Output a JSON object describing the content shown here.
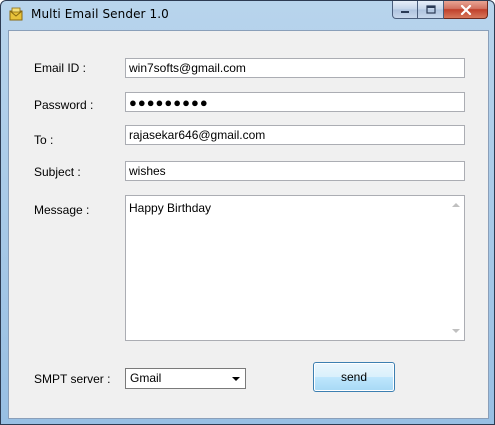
{
  "window": {
    "title": "Multi Email Sender 1.0"
  },
  "form": {
    "email_label": "Email ID :",
    "email_value": "win7softs@gmail.com",
    "password_label": "Password :",
    "password_value": "●●●●●●●●●",
    "to_label": "To :",
    "to_value": "rajasekar646@gmail.com",
    "subject_label": "Subject :",
    "subject_value": "wishes",
    "message_label": "Message :",
    "message_value": "Happy Birthday",
    "smtp_label": "SMPT server :",
    "smtp_selected": "Gmail",
    "send_label": "send"
  },
  "icons": {
    "app": "envelope-folder-icon",
    "minimize": "minimize-icon",
    "maximize": "maximize-icon",
    "close": "close-icon"
  },
  "colors": {
    "accent_border": "#3c7fb1",
    "close_red": "#c0402a",
    "frame_blue": "#98bfe3"
  }
}
